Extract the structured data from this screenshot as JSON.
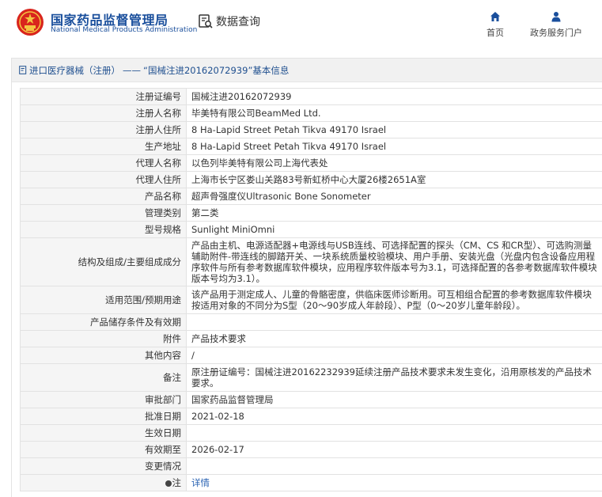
{
  "header": {
    "site_name_cn": "国家药品监督管理局",
    "site_name_en": "National Medical Products Administration",
    "query_label": "数据查询",
    "nav": [
      {
        "label": "首页",
        "icon": "home-icon"
      },
      {
        "label": "政务服务门户",
        "icon": "user-icon"
      }
    ]
  },
  "breadcrumb": {
    "category": "进口医疗器械（注册）",
    "separator": "——",
    "record": "“国械注进20162072939”基本信息"
  },
  "colors": {
    "brand_blue": "#1a4f9c",
    "logo_red": "#d9251d",
    "link_blue": "#2a63b3"
  },
  "rows": [
    {
      "key": "注册证编号",
      "value": "国械注进20162072939"
    },
    {
      "key": "注册人名称",
      "value": "毕美特有限公司BeamMed Ltd."
    },
    {
      "key": "注册人住所",
      "value": "8 Ha-Lapid Street Petah Tikva 49170 Israel"
    },
    {
      "key": "生产地址",
      "value": "8 Ha-Lapid Street Petah Tikva 49170 Israel"
    },
    {
      "key": "代理人名称",
      "value": "以色列毕美特有限公司上海代表处"
    },
    {
      "key": "代理人住所",
      "value": "上海市长宁区娄山关路83号新虹桥中心大厦26楼2651A室"
    },
    {
      "key": "产品名称",
      "value": "超声骨强度仪Ultrasonic Bone Sonometer"
    },
    {
      "key": "管理类别",
      "value": "第二类"
    },
    {
      "key": "型号规格",
      "value": "Sunlight MiniOmni"
    },
    {
      "key": "结构及组成/主要组成成分",
      "value": "产品由主机、电源适配器+电源线与USB连线、可选择配置的探头（CM、CS 和CR型）、可选购测量辅助附件-带连线的脚踏开关、一块系统质量校验模块、用户手册、安装光盘（光盘内包含设备应用程序软件与所有参考数据库软件模块，应用程序软件版本号为3.1，可选择配置的各参考数据库软件模块版本号均为3.1）。"
    },
    {
      "key": "适用范围/预期用途",
      "value": "该产品用于测定成人、儿童的骨骼密度，供临床医师诊断用。可互相组合配置的参考数据库软件模块按适用对象的不同分为S型（20～90岁成人年龄段）、P型（0～20岁儿童年龄段）。"
    },
    {
      "key": "产品储存条件及有效期",
      "value": ""
    },
    {
      "key": "附件",
      "value": "产品技术要求"
    },
    {
      "key": "其他内容",
      "value": "/"
    },
    {
      "key": "备注",
      "value": "原注册证编号：国械注进20162232939延续注册产品技术要求未发生变化，沿用原核发的产品技术要求。"
    },
    {
      "key": "审批部门",
      "value": "国家药品监督管理局"
    },
    {
      "key": "批准日期",
      "value": "2021-02-18"
    },
    {
      "key": "生效日期",
      "value": ""
    },
    {
      "key": "有效期至",
      "value": "2026-02-17"
    },
    {
      "key": "变更情况",
      "value": ""
    },
    {
      "key": "注",
      "value": "详情"
    }
  ]
}
